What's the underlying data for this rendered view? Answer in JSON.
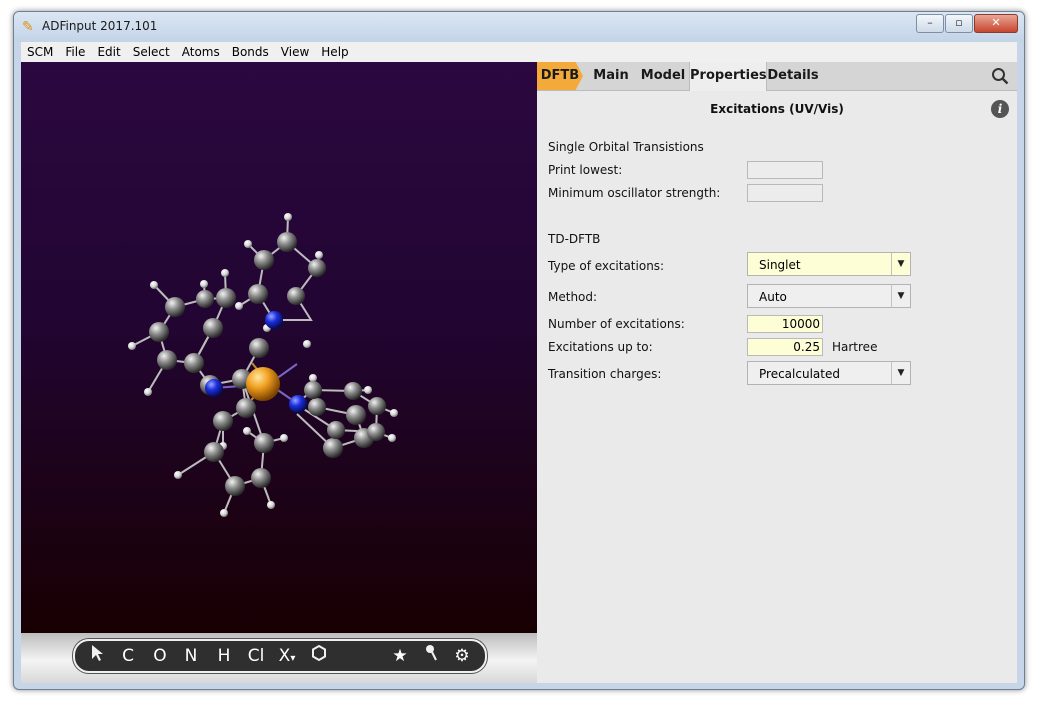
{
  "window": {
    "title": "ADFinput 2017.101"
  },
  "menu": [
    "SCM",
    "File",
    "Edit",
    "Select",
    "Atoms",
    "Bonds",
    "View",
    "Help"
  ],
  "tabs": [
    {
      "label": "DFTB"
    },
    {
      "label": "Main"
    },
    {
      "label": "Model"
    },
    {
      "label": "Properties",
      "active": true
    },
    {
      "label": "Details"
    }
  ],
  "panel": {
    "title": "Excitations (UV/Vis)",
    "info_icon": "i",
    "sot": {
      "heading": "Single Orbital Transistions",
      "print_lowest_label": "Print lowest:",
      "print_lowest_value": "",
      "min_osc_label": "Minimum oscillator strength:",
      "min_osc_value": ""
    },
    "tddftb": {
      "heading": "TD-DFTB",
      "type_label": "Type of excitations:",
      "type_value": "Singlet",
      "method_label": "Method:",
      "method_value": "Auto",
      "num_label": "Number of excitations:",
      "num_value": "10000",
      "upto_label": "Excitations up to:",
      "upto_value": "0.25",
      "upto_unit": "Hartree",
      "charges_label": "Transition charges:",
      "charges_value": "Precalculated"
    }
  },
  "toolbar": {
    "items": [
      "C",
      "O",
      "N",
      "H",
      "Cl",
      "X",
      "H"
    ],
    "x_arrow": "▾"
  },
  "colors": {
    "accent_dftb": "#f4aa3a",
    "viewport_top": "#2b0840",
    "viewport_bottom": "#180002",
    "field_yellow": "#fefed6",
    "atom_carbon": "#9a9a9a",
    "atom_nitrogen": "#2233dd",
    "atom_metal": "#f0a020"
  }
}
